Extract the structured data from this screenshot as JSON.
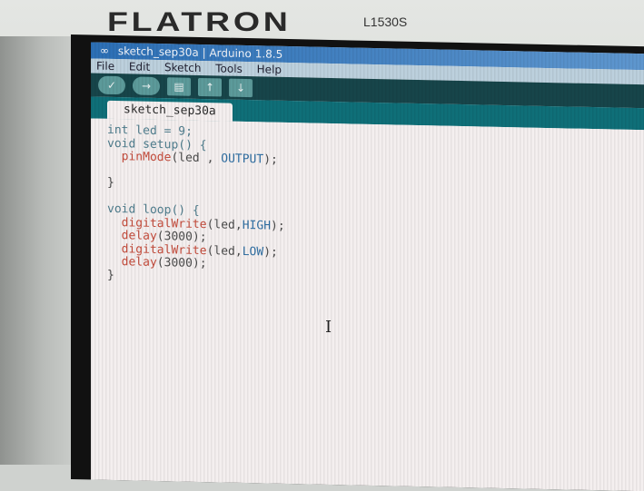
{
  "monitor": {
    "brand": "FLATRON",
    "model": "L1530S"
  },
  "window": {
    "title": "sketch_sep30a | Arduino 1.8.5"
  },
  "menu": [
    "File",
    "Edit",
    "Sketch",
    "Tools",
    "Help"
  ],
  "toolbar": {
    "buttons": [
      {
        "name": "verify",
        "icon": "check-icon",
        "glyph": "✓"
      },
      {
        "name": "upload",
        "icon": "arrow-right-icon",
        "glyph": "→"
      },
      {
        "name": "new",
        "icon": "new-file-icon",
        "glyph": "▤"
      },
      {
        "name": "open",
        "icon": "arrow-up-icon",
        "glyph": "↑"
      },
      {
        "name": "save",
        "icon": "arrow-down-icon",
        "glyph": "↓"
      }
    ]
  },
  "tab": {
    "label": "sketch_sep30a"
  },
  "code": {
    "line1": "int led = 9;",
    "line2a": "void setup() {",
    "line3_fn": "pinMode",
    "line3_args": "(led , ",
    "line3_const": "OUTPUT",
    "line3_end": ");",
    "line4": "}",
    "line6": "void loop() {",
    "line7_fn": "digitalWrite",
    "line7_args": "(led,",
    "line7_const": "HIGH",
    "line7_end": ");",
    "line8_fn": "delay",
    "line8_args": "(3000);",
    "line9_fn": "digitalWrite",
    "line9_args": "(led,",
    "line9_const": "LOW",
    "line9_end": ");",
    "line10_fn": "delay",
    "line10_args": "(3000);",
    "line11": "}"
  }
}
